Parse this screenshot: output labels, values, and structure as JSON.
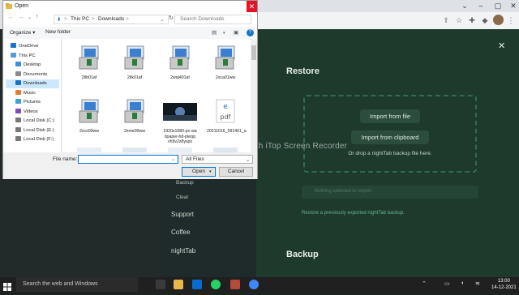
{
  "colors": {
    "accent": "#0078d7",
    "page_bg": "#1c2b23",
    "panel_bg": "#1e3a2d",
    "close_red": "#e81123"
  },
  "dialog": {
    "title": "Open",
    "address": {
      "root": "This PC",
      "folder": "Downloads",
      "separator": ">"
    },
    "search_placeholder": "Search Downloads",
    "organize": "Organize ▾",
    "new_folder": "New folder",
    "nav_items": [
      "OneDrive",
      "This PC",
      "Desktop",
      "Documents",
      "Downloads",
      "Music",
      "Pictures",
      "Videos",
      "Local Disk (C:)",
      "Local Disk (E:)",
      "Local Disk (F:)"
    ],
    "selected_nav": "Downloads",
    "files": [
      {
        "name": "2tlb01af",
        "icon": "installer-icon"
      },
      {
        "name": "2tlk01af",
        "icon": "installer-icon"
      },
      {
        "name": "2wqi401af",
        "icon": "installer-icon"
      },
      {
        "name": "2xca01ww",
        "icon": "installer-icon"
      },
      {
        "name": "2xcs00ww",
        "icon": "installer-icon"
      },
      {
        "name": "2xme00ww",
        "icon": "installer-icon"
      },
      {
        "name": "1920x1080-pc-wa llpaper-hd-pieqq vh9v2z8yspx",
        "icon": "image-thumbnail"
      },
      {
        "name": "20211016_091401_a",
        "icon": "pdf-icon"
      }
    ],
    "filename_label": "File name:",
    "filetype": "All Files",
    "open_label": "Open",
    "cancel_label": "Cancel"
  },
  "nighttab": {
    "restore_heading": "Restore",
    "import_file": "Import from file",
    "import_clipboard": "Import from clipboard",
    "drop_hint": "Or drop a nightTab backup file here.",
    "status_placeholder": "Nothing selected to import.",
    "restore_hint": "Restore a previously exported nightTab backup.",
    "backup_heading": "Backup",
    "menu": {
      "sub_backup": "Backup",
      "sub_clear": "Clear",
      "support": "Support",
      "coffee": "Coffee",
      "nighttab": "nightTab"
    },
    "close": "✕"
  },
  "watermark": "Recorded with iTop Screen Recorder",
  "taskbar": {
    "search": "Search the web and Windows",
    "time": "13:00",
    "date": "14-12-2021"
  }
}
